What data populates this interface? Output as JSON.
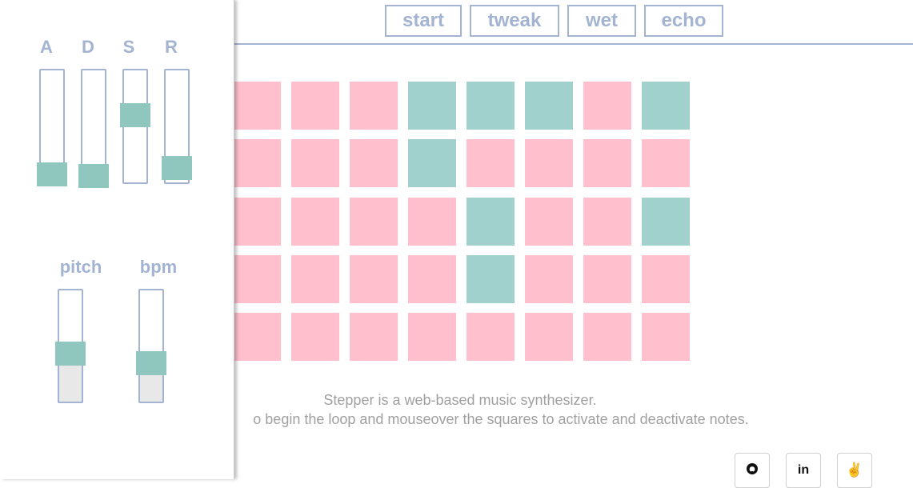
{
  "nav": {
    "buttons": [
      {
        "label": "start"
      },
      {
        "label": "tweak"
      },
      {
        "label": "wet"
      },
      {
        "label": "echo"
      }
    ]
  },
  "sequencer": {
    "colors": {
      "off": "#ffbfcc",
      "on": "#a0d1cc"
    },
    "rows": [
      [
        0,
        0,
        0,
        1,
        1,
        1,
        0,
        1
      ],
      [
        0,
        0,
        0,
        1,
        0,
        0,
        0,
        0
      ],
      [
        0,
        0,
        0,
        0,
        1,
        0,
        0,
        1
      ],
      [
        0,
        0,
        0,
        0,
        1,
        0,
        0,
        0
      ],
      [
        0,
        0,
        0,
        0,
        0,
        0,
        0,
        0
      ]
    ]
  },
  "description": {
    "line1": "Stepper is a web-based music synthesizer.",
    "line2": "o begin the loop and mouseover the squares to activate and deactivate notes."
  },
  "social": [
    "github-icon",
    "linkedin-icon",
    "peace-icon"
  ],
  "panel": {
    "adsr": [
      {
        "label": "A",
        "level": 0.05
      },
      {
        "label": "D",
        "level": 0.03
      },
      {
        "label": "S",
        "level": 0.65
      },
      {
        "label": "R",
        "level": 0.1
      }
    ],
    "pitch": {
      "label": "pitch",
      "level": 0.45
    },
    "bpm": {
      "label": "bpm",
      "level": 0.35
    }
  }
}
